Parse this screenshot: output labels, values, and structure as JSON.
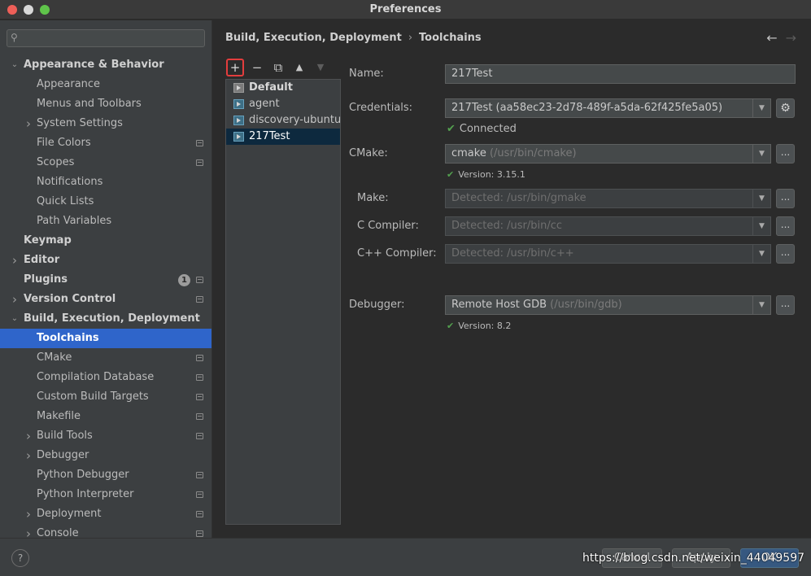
{
  "window": {
    "title": "Preferences"
  },
  "search": {
    "placeholder": ""
  },
  "sidebar": {
    "items": [
      {
        "label": "Appearance & Behavior",
        "level": 0,
        "arrow": "down"
      },
      {
        "label": "Appearance",
        "level": 1
      },
      {
        "label": "Menus and Toolbars",
        "level": 1
      },
      {
        "label": "System Settings",
        "level": 1,
        "arrow": "right"
      },
      {
        "label": "File Colors",
        "level": 1,
        "proj": true
      },
      {
        "label": "Scopes",
        "level": 1,
        "proj": true
      },
      {
        "label": "Notifications",
        "level": 1
      },
      {
        "label": "Quick Lists",
        "level": 1
      },
      {
        "label": "Path Variables",
        "level": 1
      },
      {
        "label": "Keymap",
        "level": 0
      },
      {
        "label": "Editor",
        "level": 0,
        "arrow": "right"
      },
      {
        "label": "Plugins",
        "level": 0,
        "badge": "1",
        "proj": true
      },
      {
        "label": "Version Control",
        "level": 0,
        "arrow": "right",
        "proj": true
      },
      {
        "label": "Build, Execution, Deployment",
        "level": 0,
        "arrow": "down"
      },
      {
        "label": "Toolchains",
        "level": 1,
        "selected": true
      },
      {
        "label": "CMake",
        "level": 1,
        "proj": true
      },
      {
        "label": "Compilation Database",
        "level": 1,
        "proj": true
      },
      {
        "label": "Custom Build Targets",
        "level": 1,
        "proj": true
      },
      {
        "label": "Makefile",
        "level": 1,
        "proj": true
      },
      {
        "label": "Build Tools",
        "level": 1,
        "arrow": "right",
        "proj": true
      },
      {
        "label": "Debugger",
        "level": 1,
        "arrow": "right"
      },
      {
        "label": "Python Debugger",
        "level": 1,
        "proj": true
      },
      {
        "label": "Python Interpreter",
        "level": 1,
        "proj": true
      },
      {
        "label": "Deployment",
        "level": 1,
        "arrow": "right",
        "proj": true
      },
      {
        "label": "Console",
        "level": 1,
        "arrow": "right",
        "proj": true
      }
    ]
  },
  "breadcrumb": {
    "parent": "Build, Execution, Deployment",
    "separator": "›",
    "current": "Toolchains"
  },
  "toolchain_toolbar": {
    "add": "+",
    "remove": "−",
    "copy": "⧉",
    "up": "▲",
    "down": "▼"
  },
  "toolchains": [
    {
      "name": "Default",
      "bold": true,
      "default": true
    },
    {
      "name": "agent"
    },
    {
      "name": "discovery-ubuntu"
    },
    {
      "name": "217Test",
      "selected": true
    }
  ],
  "form": {
    "name_label": "Name:",
    "name_value": "217Test",
    "credentials_label": "Credentials:",
    "credentials_value": "217Test (aa58ec23-2d78-489f-a5da-62f425fe5a05)",
    "connected": "Connected",
    "cmake_label": "CMake:",
    "cmake_value": "cmake",
    "cmake_path": "(/usr/bin/cmake)",
    "cmake_version": "Version: 3.15.1",
    "make_label": "Make:",
    "make_value": "Detected: /usr/bin/gmake",
    "c_label": "C Compiler:",
    "c_value": "Detected: /usr/bin/cc",
    "cpp_label": "C++ Compiler:",
    "cpp_value": "Detected: /usr/bin/c++",
    "debugger_label": "Debugger:",
    "debugger_value": "Remote Host GDB",
    "debugger_path": "(/usr/bin/gdb)",
    "debugger_version": "Version: 8.2",
    "ellipsis": "..."
  },
  "buttons": {
    "help": "?",
    "cancel": "Cancel",
    "apply": "Apply",
    "ok": "OK"
  },
  "watermark": "https://blog.csdn.net/weixin_44049597",
  "colors": {
    "selection": "#2f65ca",
    "list_selection": "#0d293e",
    "check": "#53a04f",
    "add_highlight": "#e33d3d"
  }
}
